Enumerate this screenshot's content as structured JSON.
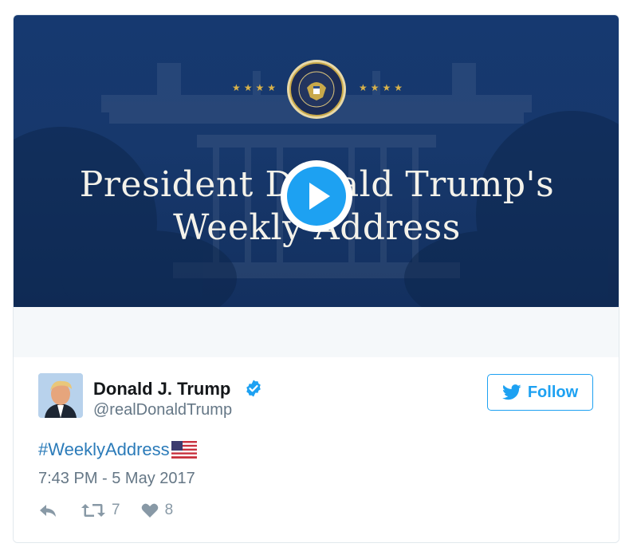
{
  "media": {
    "title_line1": "President Donald Trump's",
    "title_line2": "Weekly Address",
    "stars_left": "★★★★",
    "stars_right": "★★★★",
    "play_icon": "play-icon"
  },
  "tweet": {
    "author": {
      "name": "Donald J. Trump",
      "handle": "@realDonaldTrump",
      "verified_icon": "verified-badge-icon"
    },
    "follow_label": "Follow",
    "hashtag": "#WeeklyAddress",
    "emoji_icon": "us-flag-icon",
    "timestamp": "7:43 PM - 5 May 2017",
    "actions": {
      "reply_icon": "reply-icon",
      "retweet_icon": "retweet-icon",
      "retweet_count": "7",
      "like_icon": "heart-icon",
      "like_count": "8"
    }
  },
  "colors": {
    "accent": "#1da1f2",
    "link": "#2b7bb9",
    "media_background": "#163970",
    "muted": "#657786"
  }
}
